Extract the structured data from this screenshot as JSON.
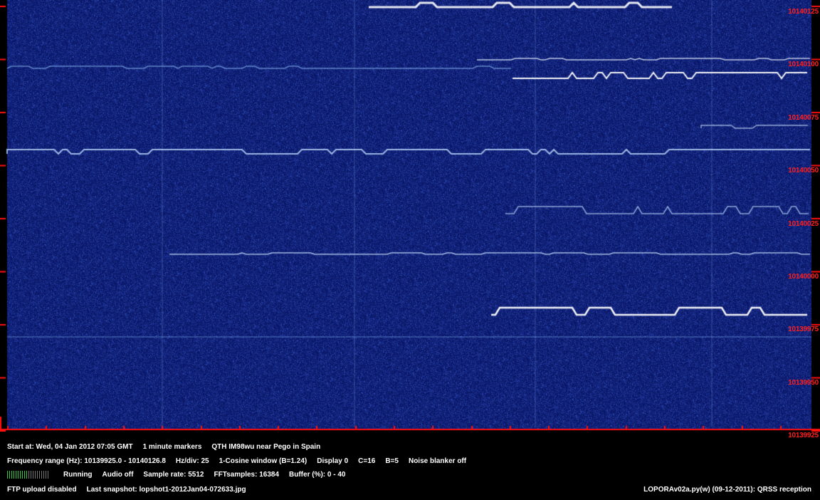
{
  "freq_labels": [
    "10140125",
    "10140100",
    "10140075",
    "10140050",
    "10140025",
    "10140000",
    "10139975",
    "10139950",
    "10139925"
  ],
  "line1": {
    "start": "Start at: Wed, 04 Jan 2012 07:05 GMT",
    "markers": "1 minute markers",
    "qth": "QTH IM98wu near Pego in Spain"
  },
  "line2": {
    "range": "Frequency range (Hz): 10139925.0 - 10140126.8",
    "hzdiv": "Hz/div: 25",
    "window": "1-Cosine window (B=1.24)",
    "display": "Display 0",
    "c": "C=16",
    "b": "B=5",
    "nb": "Noise blanker off"
  },
  "line3": {
    "level_fraction": 0.5,
    "status": "Running",
    "audio": "Audio off",
    "rate": "Sample rate: 5512",
    "fft": "FFTsamples: 16384",
    "buffer": "Buffer (%): 0 - 40"
  },
  "line4": {
    "ftp": "FTP upload disabled",
    "snapshot": "Last snapshot: lopshot1-2012Jan04-072633.jpg",
    "version": "LOPORAv02a.py(w) (09-12-2011): QRSS reception"
  },
  "colors": {
    "background": "#0a1a6e",
    "labels": "#ff2020",
    "meter_on": "#2ecc40"
  }
}
